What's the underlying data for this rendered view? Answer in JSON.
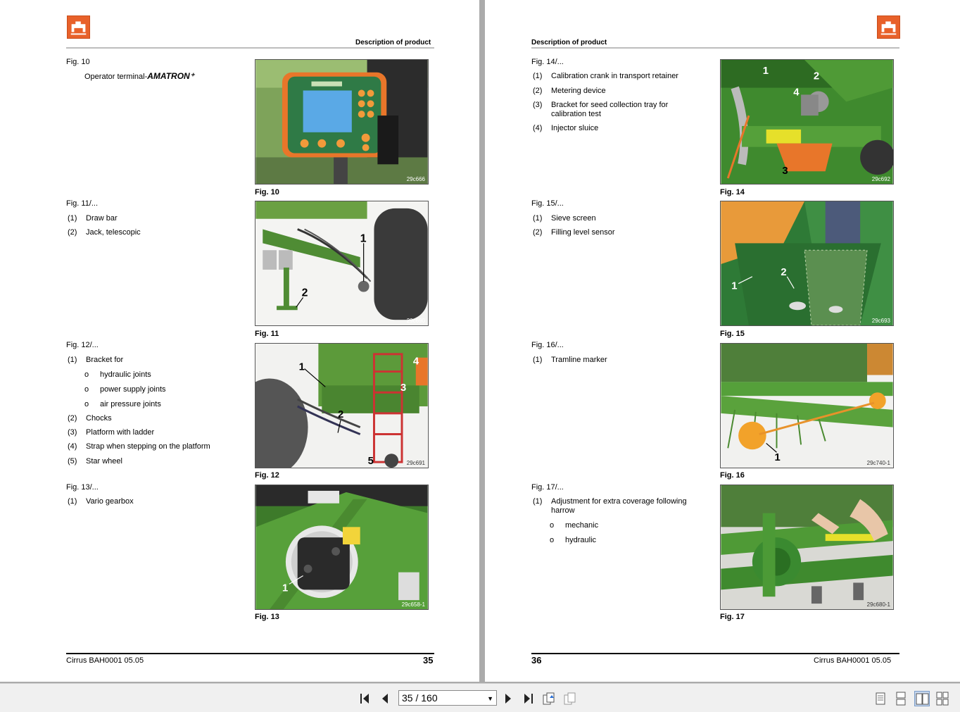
{
  "left_page": {
    "header": "Description of product",
    "footer_doc": "Cirrus  BAH0001  05.05",
    "page_number": "35",
    "figures": [
      {
        "title": "Fig. 10",
        "description": "Operator terminal-",
        "brand": "AMATRON⁺",
        "items": [],
        "image_code": "29c666",
        "label": "Fig. 10"
      },
      {
        "title": "Fig. 11/...",
        "items": [
          {
            "num": "(1)",
            "text": "Draw bar"
          },
          {
            "num": "(2)",
            "text": "Jack, telescopic"
          }
        ],
        "image_code": "29c690",
        "label": "Fig. 11"
      },
      {
        "title": "Fig. 12/...",
        "items": [
          {
            "num": "(1)",
            "text": "Bracket for"
          },
          {
            "num": "(2)",
            "text": "Chocks"
          },
          {
            "num": "(3)",
            "text": "Platform with ladder"
          },
          {
            "num": "(4)",
            "text": "Strap when stepping on the platform"
          },
          {
            "num": "(5)",
            "text": "Star wheel"
          }
        ],
        "subitems": [
          "hydraulic joints",
          "power supply joints",
          "air pressure joints"
        ],
        "image_code": "29c691",
        "label": "Fig. 12"
      },
      {
        "title": "Fig. 13/...",
        "items": [
          {
            "num": "(1)",
            "text": "Vario gearbox"
          }
        ],
        "image_code": "29c658-1",
        "label": "Fig. 13"
      }
    ]
  },
  "right_page": {
    "header": "Description of product",
    "footer_doc": "Cirrus  BAH0001  05.05",
    "page_number": "36",
    "figures": [
      {
        "title": "Fig. 14/...",
        "items": [
          {
            "num": "(1)",
            "text": "Calibration crank in transport retainer"
          },
          {
            "num": "(2)",
            "text": "Metering device"
          },
          {
            "num": "(3)",
            "text": "Bracket for seed collection tray for calibration test"
          },
          {
            "num": "(4)",
            "text": "Injector sluice"
          }
        ],
        "image_code": "29c692",
        "label": "Fig. 14"
      },
      {
        "title": "Fig. 15/...",
        "items": [
          {
            "num": "(1)",
            "text": "Sieve screen"
          },
          {
            "num": "(2)",
            "text": "Filling level sensor"
          }
        ],
        "image_code": "29c693",
        "label": "Fig. 15"
      },
      {
        "title": "Fig. 16/...",
        "items": [
          {
            "num": "(1)",
            "text": "Tramline marker"
          }
        ],
        "image_code": "29c740-1",
        "label": "Fig. 16"
      },
      {
        "title": "Fig. 17/...",
        "items": [
          {
            "num": "(1)",
            "text": "Adjustment for extra coverage following harrow"
          }
        ],
        "subitems": [
          "mechanic",
          "hydraulic"
        ],
        "image_code": "29c680-1",
        "label": "Fig. 17"
      }
    ]
  },
  "image_callouts": {
    "fig11": [
      "1",
      "2"
    ],
    "fig12": [
      "1",
      "2",
      "3",
      "4",
      "5"
    ],
    "fig13": [
      "1"
    ],
    "fig14": [
      "1",
      "2",
      "3",
      "4"
    ],
    "fig15": [
      "1",
      "2"
    ],
    "fig16": [
      "1"
    ],
    "terminal_brand": "AMATRON⁺"
  },
  "toolbar": {
    "page_indicator": "35 / 160",
    "icons": [
      "first-page-icon",
      "previous-page-icon",
      "next-page-icon",
      "last-page-icon",
      "go-back-view-icon",
      "go-forward-view-icon",
      "single-page-view-icon",
      "continuous-view-icon",
      "two-page-view-icon",
      "two-page-continuous-view-icon"
    ]
  },
  "colors": {
    "logo_orange": "#e8612a",
    "machine_green": "#3f8f2f",
    "viewer_background": "#ababab",
    "toolbar_background": "#f0f0f0"
  }
}
